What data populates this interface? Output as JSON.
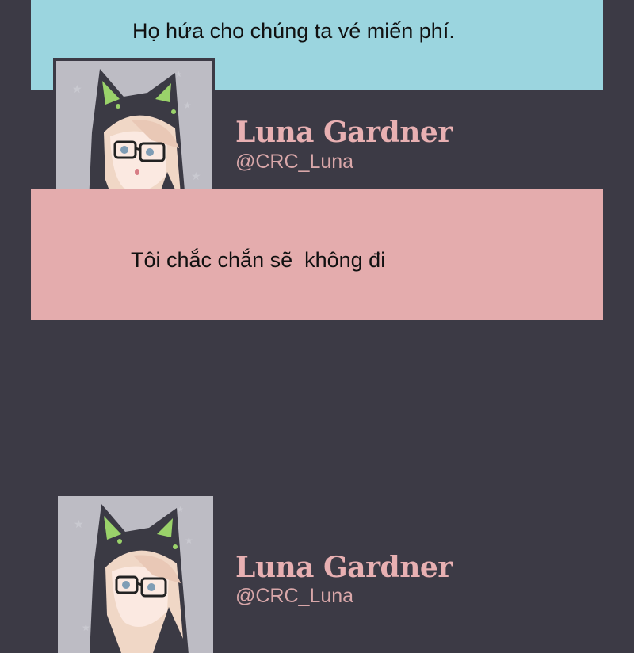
{
  "messages": [
    {
      "text": "Họ hứa cho chúng ta vé miến phí.",
      "color": "#9bd5df"
    },
    {
      "text": "Tôi chắc chắn sẽ  không đi",
      "color": "#e4acad"
    }
  ],
  "profiles": [
    {
      "name": "Luna Gardner",
      "handle": "@CRC_Luna"
    },
    {
      "name": "Luna Gardner",
      "handle": "@CRC_Luna"
    }
  ],
  "colors": {
    "background": "#3c3a45",
    "name": "#e8b0b2"
  }
}
